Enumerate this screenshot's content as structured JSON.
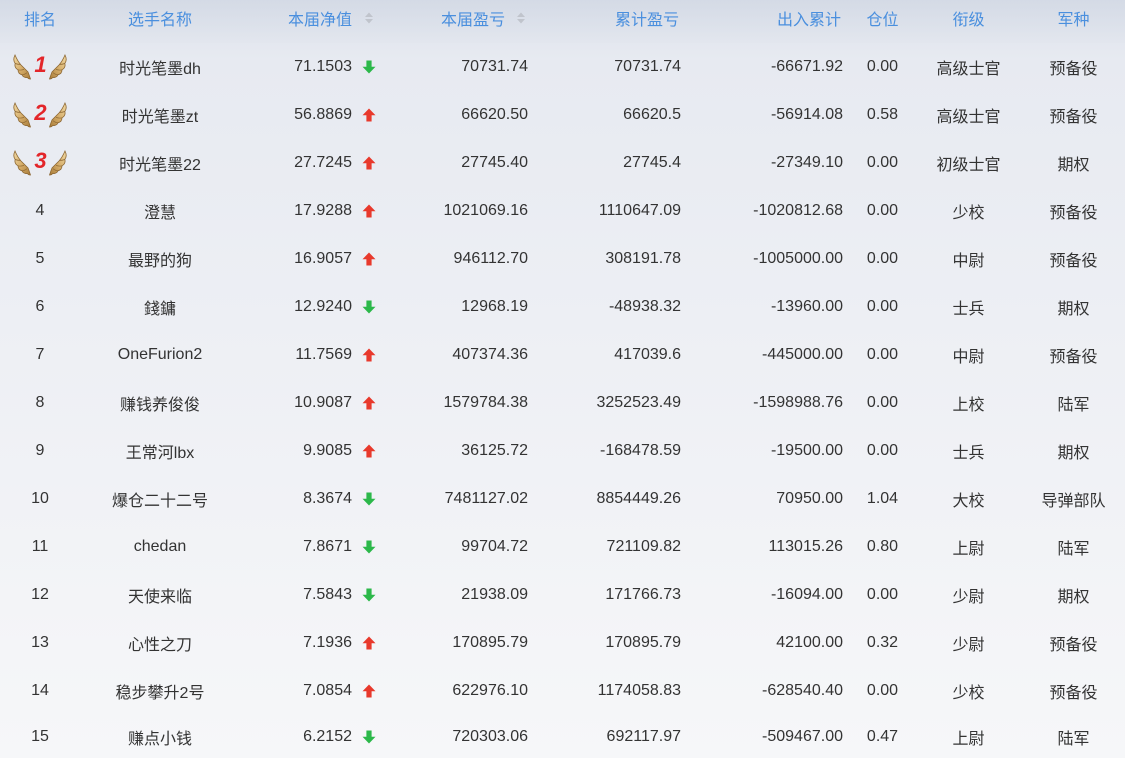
{
  "table": {
    "headers": {
      "rank": "排名",
      "name": "选手名称",
      "net": "本届净值",
      "pnl": "本届盈亏",
      "cum_pnl": "累计盈亏",
      "flow": "出入累计",
      "position": "仓位",
      "title": "衔级",
      "branch": "军种"
    },
    "rows": [
      {
        "rank": "1",
        "medal_icon": "laurel-medal-icon",
        "name": "时光笔墨dh",
        "net": "71.1503",
        "trend_icon": "arrow-down-icon",
        "pnl": "70731.74",
        "cum_pnl": "70731.74",
        "flow": "-66671.92",
        "position": "0.00",
        "title": "高级士官",
        "branch": "预备役"
      },
      {
        "rank": "2",
        "medal_icon": "laurel-medal-icon",
        "name": "时光笔墨zt",
        "net": "56.8869",
        "trend_icon": "arrow-up-icon",
        "pnl": "66620.50",
        "cum_pnl": "66620.5",
        "flow": "-56914.08",
        "position": "0.58",
        "title": "高级士官",
        "branch": "预备役"
      },
      {
        "rank": "3",
        "medal_icon": "laurel-medal-icon",
        "name": "时光笔墨22",
        "net": "27.7245",
        "trend_icon": "arrow-up-icon",
        "pnl": "27745.40",
        "cum_pnl": "27745.4",
        "flow": "-27349.10",
        "position": "0.00",
        "title": "初级士官",
        "branch": "期权"
      },
      {
        "rank": "4",
        "name": "澄慧",
        "net": "17.9288",
        "trend_icon": "arrow-up-icon",
        "pnl": "1021069.16",
        "cum_pnl": "1110647.09",
        "flow": "-1020812.68",
        "position": "0.00",
        "title": "少校",
        "branch": "预备役"
      },
      {
        "rank": "5",
        "name": "最野的狗",
        "net": "16.9057",
        "trend_icon": "arrow-up-icon",
        "pnl": "946112.70",
        "cum_pnl": "308191.78",
        "flow": "-1005000.00",
        "position": "0.00",
        "title": "中尉",
        "branch": "预备役"
      },
      {
        "rank": "6",
        "name": "錢鏞",
        "net": "12.9240",
        "trend_icon": "arrow-down-icon",
        "pnl": "12968.19",
        "cum_pnl": "-48938.32",
        "flow": "-13960.00",
        "position": "0.00",
        "title": "士兵",
        "branch": "期权"
      },
      {
        "rank": "7",
        "name": "OneFurion2",
        "net": "11.7569",
        "trend_icon": "arrow-up-icon",
        "pnl": "407374.36",
        "cum_pnl": "417039.6",
        "flow": "-445000.00",
        "position": "0.00",
        "title": "中尉",
        "branch": "预备役"
      },
      {
        "rank": "8",
        "name": "赚钱养俊俊",
        "net": "10.9087",
        "trend_icon": "arrow-up-icon",
        "pnl": "1579784.38",
        "cum_pnl": "3252523.49",
        "flow": "-1598988.76",
        "position": "0.00",
        "title": "上校",
        "branch": "陆军"
      },
      {
        "rank": "9",
        "name": "王常河lbx",
        "net": "9.9085",
        "trend_icon": "arrow-up-icon",
        "pnl": "36125.72",
        "cum_pnl": "-168478.59",
        "flow": "-19500.00",
        "position": "0.00",
        "title": "士兵",
        "branch": "期权"
      },
      {
        "rank": "10",
        "name": "爆仓二十二号",
        "net": "8.3674",
        "trend_icon": "arrow-down-icon",
        "pnl": "7481127.02",
        "cum_pnl": "8854449.26",
        "flow": "70950.00",
        "position": "1.04",
        "title": "大校",
        "branch": "导弹部队"
      },
      {
        "rank": "11",
        "name": "chedan",
        "net": "7.8671",
        "trend_icon": "arrow-down-icon",
        "pnl": "99704.72",
        "cum_pnl": "721109.82",
        "flow": "113015.26",
        "position": "0.80",
        "title": "上尉",
        "branch": "陆军"
      },
      {
        "rank": "12",
        "name": "天使来临",
        "net": "7.5843",
        "trend_icon": "arrow-down-icon",
        "pnl": "21938.09",
        "cum_pnl": "171766.73",
        "flow": "-16094.00",
        "position": "0.00",
        "title": "少尉",
        "branch": "期权"
      },
      {
        "rank": "13",
        "name": "心性之刀",
        "net": "7.1936",
        "trend_icon": "arrow-up-icon",
        "pnl": "170895.79",
        "cum_pnl": "170895.79",
        "flow": "42100.00",
        "position": "0.32",
        "title": "少尉",
        "branch": "预备役"
      },
      {
        "rank": "14",
        "name": "稳步攀升2号",
        "net": "7.0854",
        "trend_icon": "arrow-up-icon",
        "pnl": "622976.10",
        "cum_pnl": "1174058.83",
        "flow": "-628540.40",
        "position": "0.00",
        "title": "少校",
        "branch": "预备役"
      },
      {
        "rank": "15",
        "name": "赚点小钱",
        "net": "6.2152",
        "trend_icon": "arrow-down-icon",
        "pnl": "720303.06",
        "cum_pnl": "692117.97",
        "flow": "-509467.00",
        "position": "0.47",
        "title": "上尉",
        "branch": "陆军"
      }
    ]
  },
  "icons": {
    "up": "arrow-up-icon",
    "down": "arrow-down-icon",
    "medal": "laurel-medal-icon",
    "sort": "sort-icon"
  },
  "colors": {
    "header_text": "#4a8fde",
    "body_text": "#333333",
    "up_arrow": "#e8392c",
    "down_arrow": "#2cb84a",
    "medal_number": "#e3262a",
    "medal_gold_light": "#f2dba6",
    "medal_gold_dark": "#a87b38",
    "medal_outline": "#8c6631",
    "sort_icon": "#c0c4cc"
  }
}
